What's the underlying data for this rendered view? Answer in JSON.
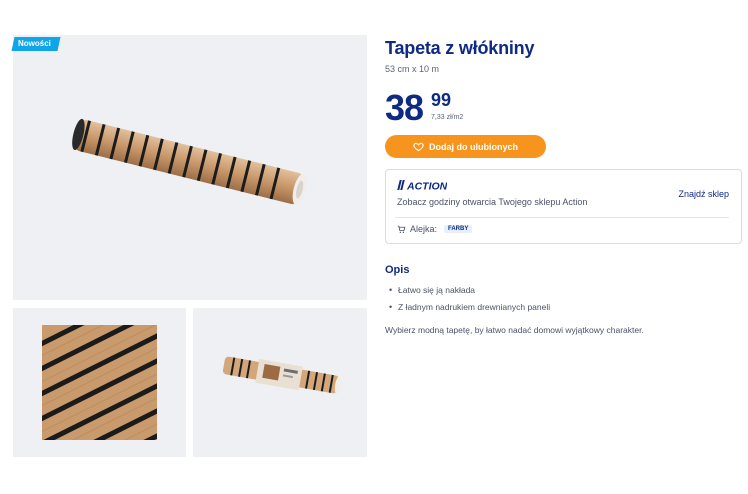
{
  "badge": {
    "label": "Nowości"
  },
  "product": {
    "title": "Tapeta z włókniny",
    "subtitle": "53 cm x 10 m",
    "price_whole": "38",
    "price_cents": "99",
    "unit_price": "7,33 zł/m2"
  },
  "favorite_button": {
    "label": "Dodaj do ulubionych",
    "icon": "heart-icon"
  },
  "store": {
    "logo_text": "ACTION",
    "hours_text": "Zobacz godziny otwarcia Twojego sklepu Action",
    "find_store_label": "Znajdź sklep",
    "aisle_label": "Alejka:",
    "aisle_value": "FARBY"
  },
  "description": {
    "title": "Opis",
    "bullets": [
      "Łatwo się ją nakłada",
      "Z ładnym nadrukiem drewnianych paneli"
    ],
    "text": "Wybierz modną tapetę, by łatwo nadać domowi wyjątkowy charakter."
  },
  "colors": {
    "brand_blue": "#0f2a83",
    "accent_orange": "#f7941d",
    "badge_blue": "#0ea5e9",
    "wood": "#c99a6b",
    "stripe": "#1b1b1b"
  }
}
